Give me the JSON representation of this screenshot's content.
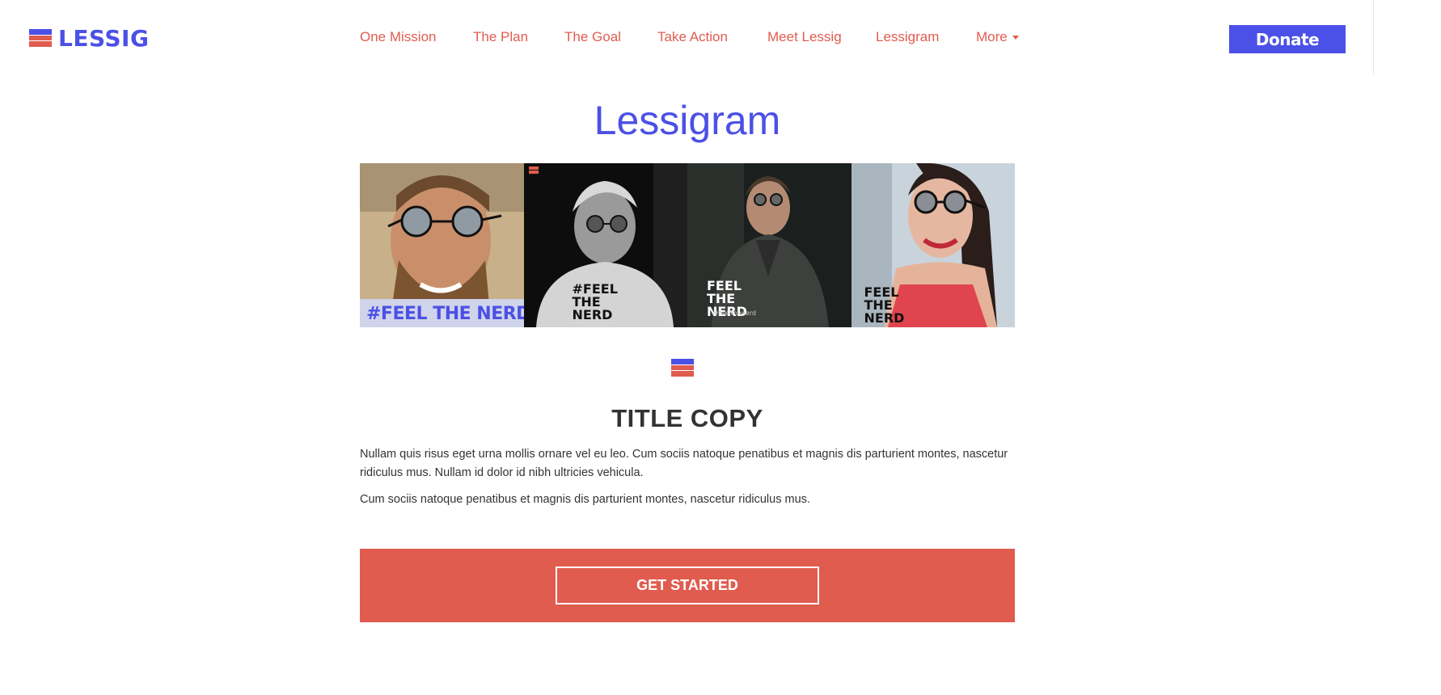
{
  "brand": {
    "logo_text": "LESSIG",
    "colors": {
      "blue": "#4b50e6",
      "red": "#e05c4f",
      "text": "#333333"
    }
  },
  "nav": {
    "items": [
      {
        "label": "One Mission"
      },
      {
        "label": "The Plan"
      },
      {
        "label": "The Goal"
      },
      {
        "label": "Take Action"
      },
      {
        "label": "Meet Lessig"
      },
      {
        "label": "Lessigram"
      },
      {
        "label": "More"
      }
    ],
    "donate_label": "Donate"
  },
  "main": {
    "title": "Lessigram",
    "gallery": [
      {
        "icon": "photo-beach-man-glasses",
        "caption": "#FEEL THE NERD"
      },
      {
        "icon": "photo-bw-man-shirt",
        "caption": "#FEEL THE NERD"
      },
      {
        "icon": "photo-man-leather-jacket",
        "caption": "FEEL THE NERD",
        "hashtag": "#feelthenerd"
      },
      {
        "icon": "photo-woman-smiling",
        "caption": "FEEL THE NERD"
      }
    ],
    "section": {
      "title": "TITLE COPY",
      "paragraphs": [
        "Nullam quis risus eget urna mollis ornare vel eu leo. Cum sociis natoque penatibus et magnis dis parturient montes, nascetur ridiculus mus. Nullam id dolor id nibh ultricies vehicula.",
        "Cum sociis natoque penatibus et magnis dis parturient montes, nascetur ridiculus mus."
      ]
    },
    "cta": {
      "label": "GET STARTED"
    }
  }
}
